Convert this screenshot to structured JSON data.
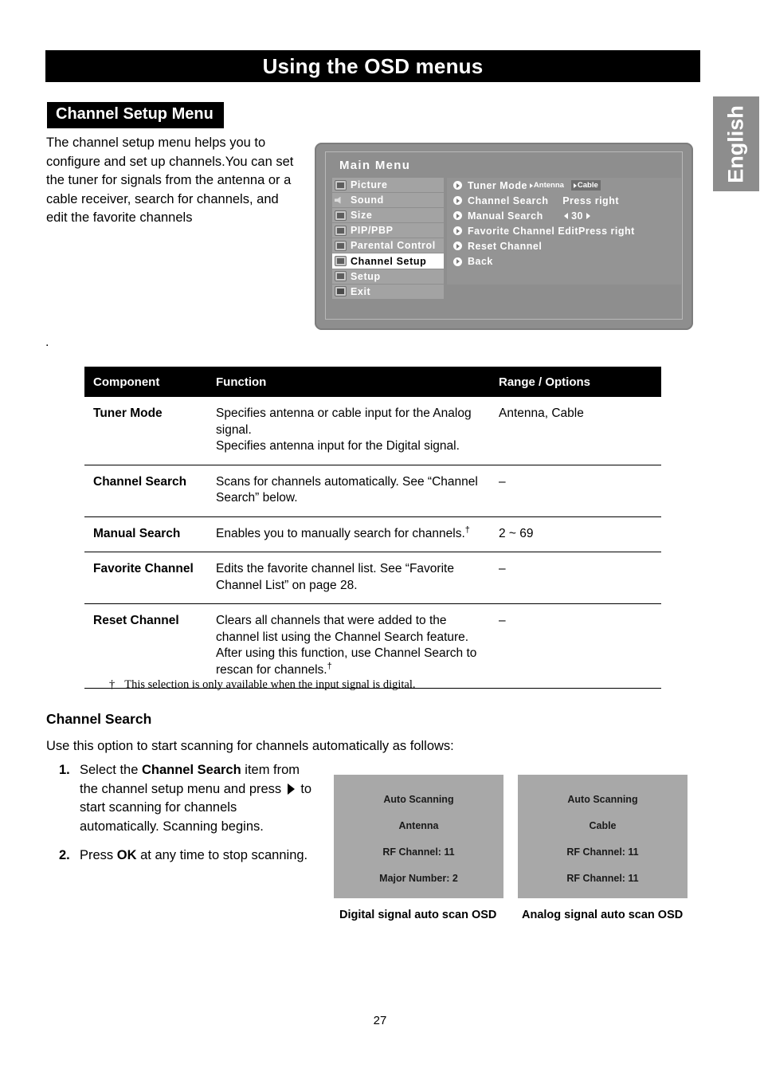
{
  "banner": {
    "title": "Using the OSD menus"
  },
  "language_tab": {
    "label": "English"
  },
  "section": {
    "heading": "Channel Setup Menu"
  },
  "intro": {
    "paragraph": "The channel setup menu helps you to configure and set up channels.You can set the tuner for signals from the antenna or a cable receiver, search for channels, and edit the favorite channels",
    "stray_mark": "."
  },
  "osd": {
    "title": "Main Menu",
    "left_items": [
      {
        "label": "Picture",
        "icon": "picture-icon",
        "selected": false
      },
      {
        "label": "Sound",
        "icon": "speaker-icon",
        "selected": false
      },
      {
        "label": "Size",
        "icon": "resize-icon",
        "selected": false
      },
      {
        "label": "PIP/PBP",
        "icon": "pip-icon",
        "selected": false
      },
      {
        "label": "Parental  Control",
        "icon": "parental-icon",
        "selected": false
      },
      {
        "label": "Channel  Setup",
        "icon": "tv-icon",
        "selected": true
      },
      {
        "label": "Setup",
        "icon": "sliders-icon",
        "selected": false
      },
      {
        "label": "Exit",
        "icon": "exit-icon",
        "selected": false
      }
    ],
    "right_rows": [
      {
        "label": "Tuner  Mode",
        "value": "",
        "options": [
          "Antenna",
          "Cable"
        ],
        "active_option": "Cable"
      },
      {
        "label": "Channel  Search",
        "value": "Press  right"
      },
      {
        "label": "Manual Search",
        "value": "30"
      },
      {
        "label": "Favorite  Channel  Edit",
        "value": "Press  right"
      },
      {
        "label": "Reset Channel",
        "value": ""
      },
      {
        "label": "Back",
        "value": ""
      }
    ]
  },
  "table": {
    "headers": [
      "Component",
      "Function",
      "Range / Options"
    ],
    "rows": [
      {
        "component": "Tuner Mode",
        "function": "Specifies antenna or cable input for the Analog signal.\nSpecifies antenna input for the Digital signal.",
        "range": "Antenna, Cable"
      },
      {
        "component": "Channel Search",
        "function": "Scans for channels automatically. See “Channel Search” below.",
        "range": "–"
      },
      {
        "component": "Manual Search",
        "function": "Enables you to manually search for channels.",
        "function_dagger": true,
        "range": "2 ~ 69"
      },
      {
        "component": "Favorite Channel",
        "function": "Edits the favorite channel list. See “Favorite Channel List” on page 28.",
        "range": "–"
      },
      {
        "component": "Reset Channel",
        "function": "Clears all channels that were added to the channel list using the Channel Search feature. After using this function, use Channel Search to rescan for channels.",
        "function_dagger": true,
        "range": "–"
      }
    ],
    "footnote_marker": "†",
    "footnote": "This selection is only available when the input signal is digital."
  },
  "channel_search": {
    "heading": "Channel Search",
    "intro": "Use this option to start scanning for channels automatically as follows:",
    "steps": [
      {
        "num": "1.",
        "parts": [
          "Select the ",
          "Channel Search",
          " item from the channel setup menu and press ",
          "RIGHT_TRIANGLE",
          " to start scanning for channels automatically. Scanning begins."
        ]
      },
      {
        "num": "2.",
        "parts": [
          "Press ",
          "OK",
          " at any time to stop scanning."
        ]
      }
    ]
  },
  "scan_osd": {
    "digital": {
      "lines": [
        "Auto Scanning",
        "Antenna",
        "RF Channel: 11",
        "Major Number: 2"
      ],
      "caption": "Digital signal auto scan OSD"
    },
    "analog": {
      "lines": [
        "Auto Scanning",
        "Cable",
        "RF Channel: 11",
        "RF Channel: 11"
      ],
      "caption": "Analog signal auto scan OSD"
    }
  },
  "footer": {
    "page_number": "27"
  },
  "colors": {
    "banner_bg": "#000000",
    "osd_bg": "#8e8e8e",
    "osd_item_bg": "#a3a3a3",
    "osd_selected_bg": "#ffffff",
    "scan_box_bg": "#a8a8a8",
    "lang_tab_bg": "#8d8d8d"
  }
}
